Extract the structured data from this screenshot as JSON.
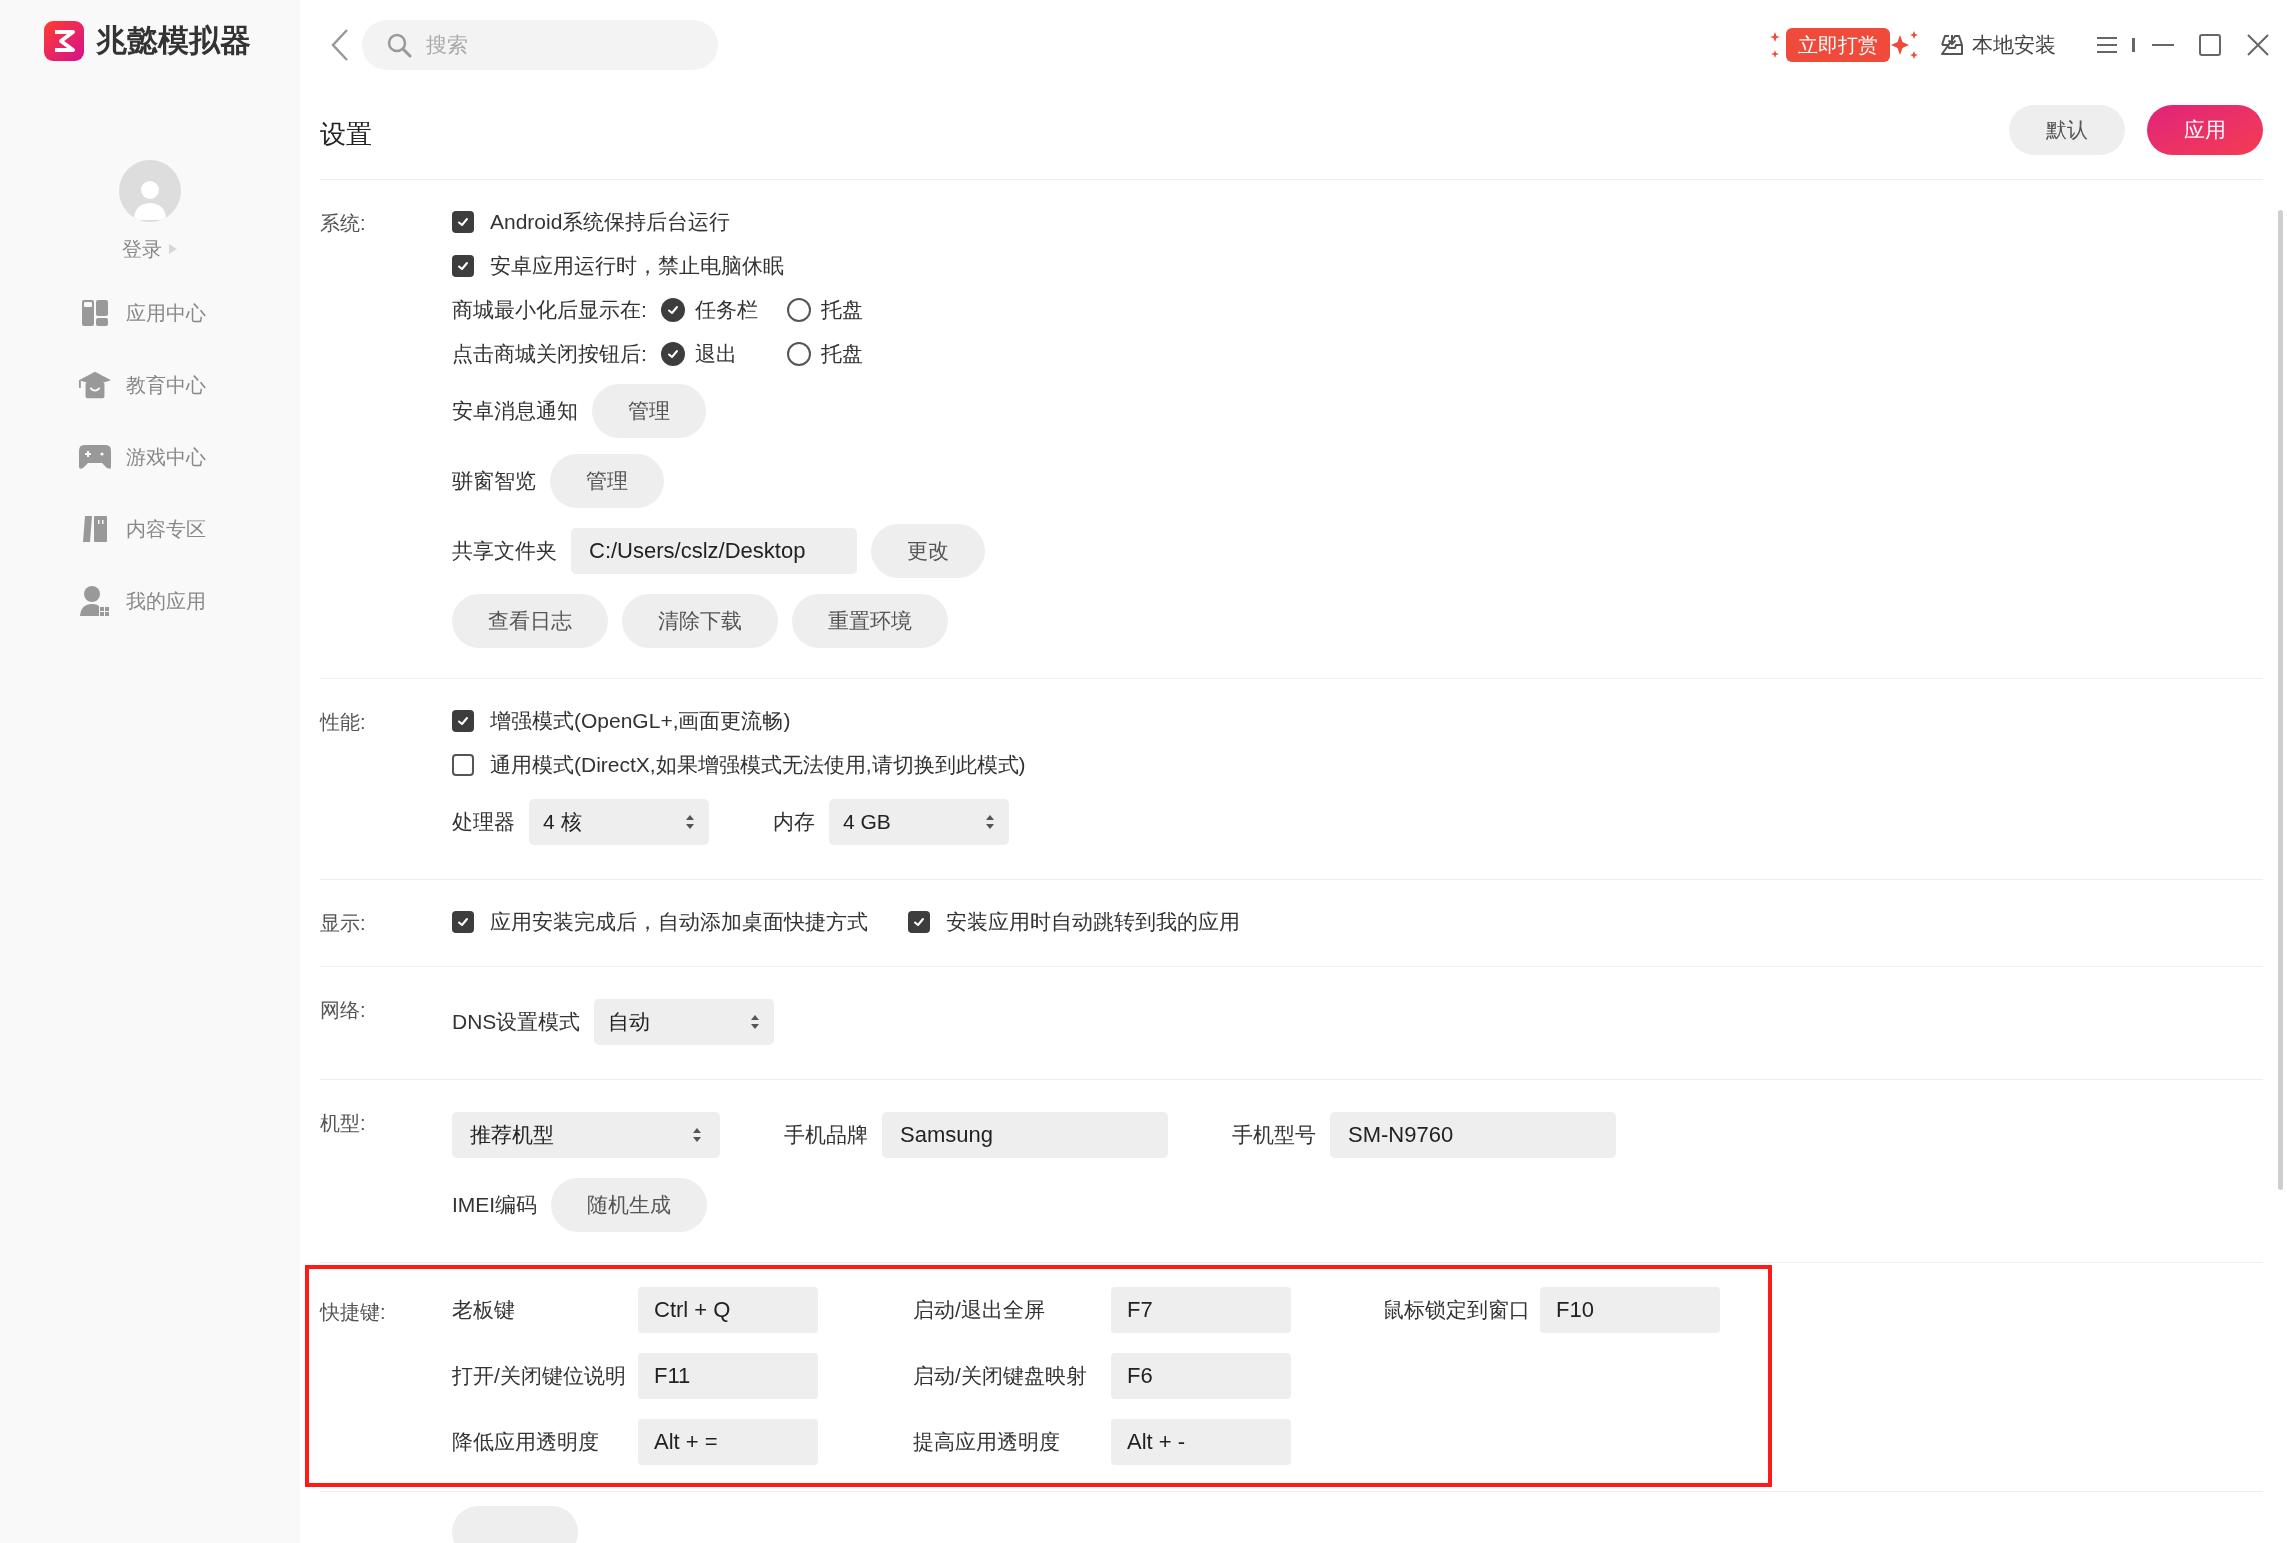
{
  "app": {
    "name": "兆懿模拟器"
  },
  "search": {
    "placeholder": "搜索"
  },
  "header": {
    "reward": "立即打赏",
    "local_install": "本地安装"
  },
  "sidebar": {
    "login": "登录",
    "items": [
      {
        "label": "应用中心",
        "kind": "apps"
      },
      {
        "label": "教育中心",
        "kind": "education"
      },
      {
        "label": "游戏中心",
        "kind": "games"
      },
      {
        "label": "内容专区",
        "kind": "content"
      },
      {
        "label": "我的应用",
        "kind": "myapps"
      }
    ]
  },
  "page": {
    "title": "设置",
    "buttons": [
      {
        "label": "默认",
        "kind": "secondary"
      },
      {
        "label": "应用",
        "kind": "primary"
      }
    ]
  },
  "sections": [
    {
      "label": "系统:",
      "kind": "options",
      "rows": [
        {
          "items": [
            {
              "kind": "checkbox",
              "label": "Android系统保持后台运行",
              "checked": true
            }
          ]
        },
        {
          "items": [
            {
              "kind": "checkbox",
              "label": "安卓应用运行时，禁止电脑休眠",
              "checked": true
            }
          ]
        },
        {
          "items": [
            {
              "kind": "text",
              "label": "商城最小化后显示在:"
            },
            {
              "kind": "radio",
              "label": "任务栏",
              "selected": true
            },
            {
              "kind": "radio",
              "label": "托盘",
              "selected": false
            }
          ]
        },
        {
          "items": [
            {
              "kind": "text",
              "label": "点击商城关闭按钮后:"
            },
            {
              "kind": "radio",
              "label": "退出",
              "selected": true
            },
            {
              "kind": "radio",
              "label": "托盘",
              "selected": false
            }
          ]
        },
        {
          "items": [
            {
              "kind": "text",
              "label": "安卓消息通知"
            },
            {
              "kind": "button",
              "label": "管理"
            }
          ]
        },
        {
          "items": [
            {
              "kind": "text",
              "label": "骈窗智览"
            },
            {
              "kind": "button",
              "label": "管理"
            }
          ]
        },
        {
          "items": [
            {
              "kind": "text",
              "label": "共享文件夹"
            },
            {
              "kind": "field",
              "value": "C:/Users/cslz/Desktop"
            },
            {
              "kind": "button",
              "label": "更改"
            }
          ]
        },
        {
          "items": [
            {
              "kind": "button",
              "label": "查看日志"
            },
            {
              "kind": "button",
              "label": "清除下载"
            },
            {
              "kind": "button",
              "label": "重置环境"
            }
          ]
        }
      ]
    },
    {
      "label": "性能:",
      "kind": "options",
      "rows": [
        {
          "items": [
            {
              "kind": "checkbox",
              "label": "增强模式(OpenGL+,画面更流畅)",
              "checked": true
            }
          ]
        },
        {
          "items": [
            {
              "kind": "checkbox",
              "label": "通用模式(DirectX,如果增强模式无法使用,请切换到此模式)",
              "checked": false
            }
          ]
        },
        {
          "items": [
            {
              "kind": "text",
              "label": "处理器"
            },
            {
              "kind": "select",
              "value": "4 核"
            },
            {
              "kind": "text",
              "label": "内存"
            },
            {
              "kind": "select",
              "value": "4 GB"
            }
          ]
        }
      ]
    },
    {
      "label": "显示:",
      "kind": "options",
      "rows": [
        {
          "items": [
            {
              "kind": "checkbox",
              "label": "应用安装完成后，自动添加桌面快捷方式",
              "checked": true
            },
            {
              "kind": "checkbox",
              "label": "安装应用时自动跳转到我的应用",
              "checked": true
            }
          ]
        }
      ]
    },
    {
      "label": "网络:",
      "kind": "options",
      "rows": [
        {
          "items": [
            {
              "kind": "text",
              "label": "DNS设置模式"
            },
            {
              "kind": "select",
              "value": "自动"
            }
          ]
        }
      ]
    },
    {
      "label": "机型:",
      "kind": "options",
      "rows": [
        {
          "items": [
            {
              "kind": "select",
              "value": "推荐机型"
            },
            {
              "kind": "text",
              "label": "手机品牌"
            },
            {
              "kind": "field",
              "value": "Samsung"
            },
            {
              "kind": "text",
              "label": "手机型号"
            },
            {
              "kind": "field",
              "value": "SM-N9760"
            }
          ]
        },
        {
          "items": [
            {
              "kind": "text",
              "label": "IMEI编码"
            },
            {
              "kind": "button",
              "label": "随机生成"
            }
          ]
        }
      ]
    },
    {
      "label": "快捷键:",
      "kind": "shortcuts",
      "highlighted": true,
      "rows": [
        {
          "entries": [
            {
              "label": "老板键",
              "value": "Ctrl + Q"
            },
            {
              "label": "启动/退出全屏",
              "value": "F7"
            },
            {
              "label": "鼠标锁定到窗口",
              "value": "F10"
            }
          ]
        },
        {
          "entries": [
            {
              "label": "打开/关闭键位说明",
              "value": "F11"
            },
            {
              "label": "启动/关闭键盘映射",
              "value": "F6"
            }
          ]
        },
        {
          "entries": [
            {
              "label": "降低应用透明度",
              "value": "Alt + ="
            },
            {
              "label": "提高应用透明度",
              "value": "Alt + -"
            }
          ]
        }
      ]
    }
  ]
}
